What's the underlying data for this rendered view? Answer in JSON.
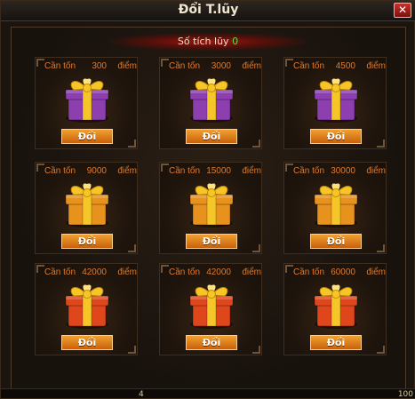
{
  "window": {
    "title": "Đổi T.lũy",
    "close_glyph": "✕"
  },
  "points": {
    "label": "Số tích lũy",
    "value": "0"
  },
  "rewards": [
    {
      "cost_label": "Cần tốn",
      "cost": "300",
      "unit": "điểm",
      "button": "Đổi",
      "gift_color": "purple"
    },
    {
      "cost_label": "Cần tốn",
      "cost": "3000",
      "unit": "điểm",
      "button": "Đổi",
      "gift_color": "purple"
    },
    {
      "cost_label": "Cần tốn",
      "cost": "4500",
      "unit": "điểm",
      "button": "Đổi",
      "gift_color": "purple"
    },
    {
      "cost_label": "Cần tốn",
      "cost": "9000",
      "unit": "điểm",
      "button": "Đổi",
      "gift_color": "orange"
    },
    {
      "cost_label": "Cần tốn",
      "cost": "15000",
      "unit": "điểm",
      "button": "Đổi",
      "gift_color": "orange"
    },
    {
      "cost_label": "Cần tốn",
      "cost": "30000",
      "unit": "điểm",
      "button": "Đổi",
      "gift_color": "orange"
    },
    {
      "cost_label": "Cần tốn",
      "cost": "42000",
      "unit": "điểm",
      "button": "Đổi",
      "gift_color": "red"
    },
    {
      "cost_label": "Cần tốn",
      "cost": "42000",
      "unit": "điểm",
      "button": "Đổi",
      "gift_color": "red"
    },
    {
      "cost_label": "Cần tốn",
      "cost": "60000",
      "unit": "điểm",
      "button": "Đổi",
      "gift_color": "red"
    }
  ],
  "bottom_bar": {
    "left_num": "4",
    "right_num": "100"
  },
  "colors": {
    "purple": "#8d3fb0",
    "orange": "#e8921e",
    "red": "#e0461c",
    "bow": "#f6c628",
    "cost_text": "#e07a2a",
    "points_value": "#59e04a"
  }
}
